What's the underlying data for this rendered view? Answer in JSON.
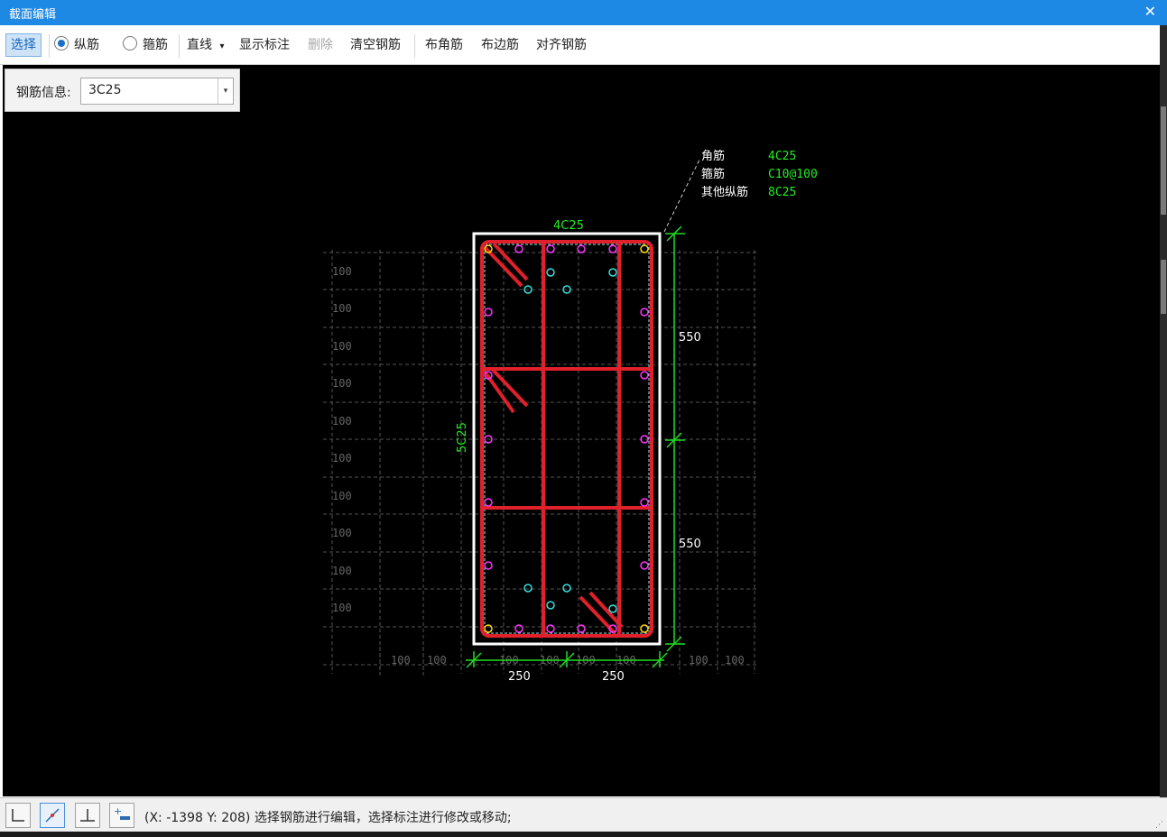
{
  "window": {
    "title": "截面编辑",
    "close_glyph": "✕"
  },
  "toolbar": {
    "select": "选择",
    "longitudinal": "纵筋",
    "stirrup": "箍筋",
    "line": "直线",
    "line_dropdown": "▾",
    "show_annotation": "显示标注",
    "delete": "删除",
    "clear_rebar": "清空钢筋",
    "corner_rebar": "布角筋",
    "edge_rebar": "布边筋",
    "align_rebar": "对齐钢筋",
    "mode_selected": "纵筋"
  },
  "rebar_info": {
    "label": "钢筋信息:",
    "value": "3C25",
    "dropdown_glyph": "▾"
  },
  "drawing": {
    "summary": [
      {
        "name": "角筋",
        "value": "4C25"
      },
      {
        "name": "箍筋",
        "value": "C10@100"
      },
      {
        "name": "其他纵筋",
        "value": "8C25"
      }
    ],
    "top_rebar": "4C25",
    "side_rebar": "5C25",
    "dim_vertical": [
      "550",
      "550"
    ],
    "dim_horizontal": [
      "250",
      "250"
    ],
    "grid_label": "100",
    "colors": {
      "background": "#000000",
      "stirrup": "#e0202a",
      "rebar_point": "#ff33ff",
      "corner_point": "#ffd700",
      "stirrup_point": "#33e0e0",
      "dimension": "#22dd22",
      "annotation": "#22ee22",
      "grid": "#555555",
      "section_outline": "#ffffff"
    }
  },
  "status": {
    "coords": "(X: -1398 Y: 208)",
    "message": "选择钢筋进行编辑，选择标注进行修改或移动;",
    "tools": [
      "ortho-icon",
      "polar-icon",
      "perpendicular-icon",
      "snap-icon"
    ]
  }
}
